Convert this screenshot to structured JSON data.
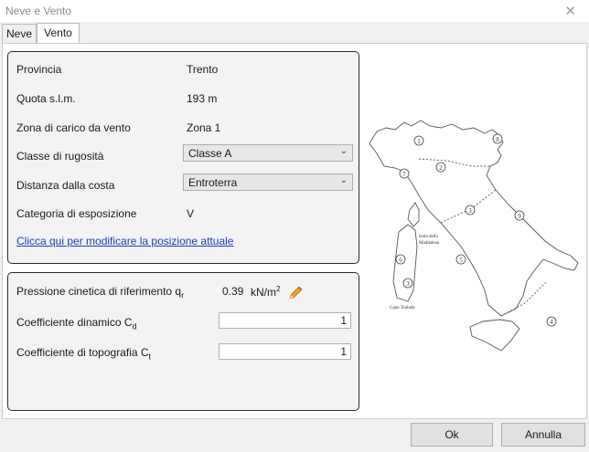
{
  "window": {
    "title": "Neve e Vento",
    "close_glyph": "✕"
  },
  "tabs": [
    {
      "label": "Neve"
    },
    {
      "label": "Vento"
    }
  ],
  "location": {
    "provincia": {
      "label": "Provincia",
      "value": "Trento"
    },
    "quota": {
      "label": "Quota s.l.m.",
      "value": "193 m"
    },
    "zona": {
      "label": "Zona di carico da vento",
      "value": "Zona 1"
    },
    "rugosita": {
      "label": "Classe di rugosità",
      "value": "Classe A"
    },
    "distanza": {
      "label": "Distanza dalla costa",
      "value": "Entroterra"
    },
    "categoria": {
      "label": "Categoria di esposizione",
      "value": "V"
    },
    "link": "Clicca qui per modificare la posizione attuale"
  },
  "params": {
    "pressione": {
      "label": "Pressione cinetica di riferimento q",
      "sub": "r",
      "value": "0.39",
      "unit": "kN/m",
      "unit_sup": "2"
    },
    "dinamico": {
      "label": "Coefficiente dinamico C",
      "sub": "d",
      "value": "1"
    },
    "topografia": {
      "label": "Coefficiente di topografia C",
      "sub": "t",
      "value": "1"
    }
  },
  "map": {
    "zones": [
      "1",
      "2",
      "3",
      "4",
      "5",
      "6",
      "7",
      "8",
      "9"
    ],
    "labels": {
      "isola": "Isola della",
      "maddalena": "Maddalena",
      "capo": "Capo Teulada"
    }
  },
  "buttons": {
    "ok": "Ok",
    "cancel": "Annulla"
  },
  "icons": {
    "chevron": "⌄",
    "edit": "pencil-icon"
  }
}
